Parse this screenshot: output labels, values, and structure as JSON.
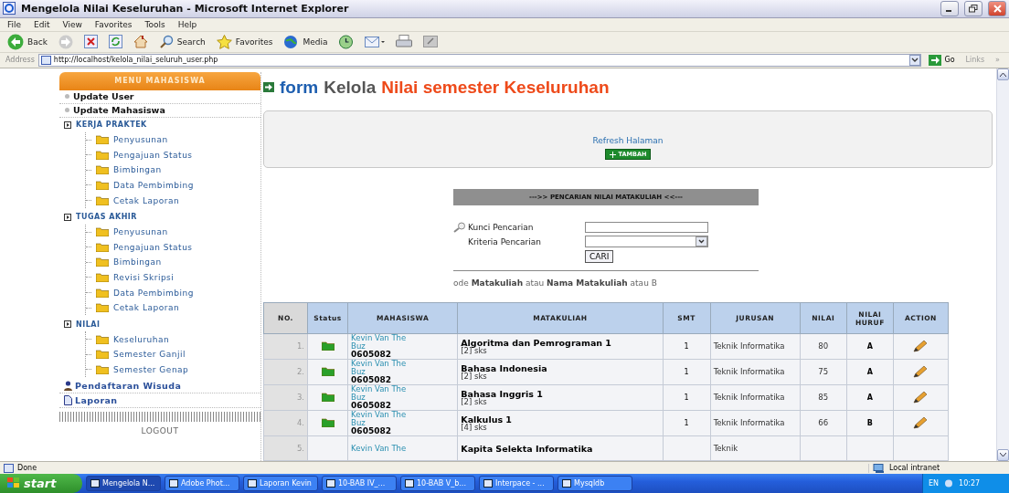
{
  "window": {
    "title": "Mengelola Nilai Keseluruhan - Microsoft Internet Explorer"
  },
  "menu": [
    "File",
    "Edit",
    "View",
    "Favorites",
    "Tools",
    "Help"
  ],
  "toolbar": [
    {
      "kind": "back",
      "label": "Back"
    },
    {
      "kind": "forward"
    },
    {
      "kind": "stop"
    },
    {
      "kind": "refresh"
    },
    {
      "kind": "home"
    },
    {
      "kind": "search",
      "label": "Search"
    },
    {
      "kind": "favorites",
      "label": "Favorites"
    },
    {
      "kind": "media",
      "label": "Media"
    },
    {
      "kind": "history"
    },
    {
      "kind": "mail"
    },
    {
      "kind": "print"
    },
    {
      "kind": "edit"
    }
  ],
  "address_bar": {
    "label": "Address",
    "url": "http://localhost/kelola_nilai_seluruh_user.php",
    "go": "Go",
    "links": "Links",
    "more": "»"
  },
  "sidebar": {
    "title": "MENU MAHASISWA",
    "logout": "LOGOUT",
    "items": [
      {
        "kind": "bullet",
        "label": "Update User"
      },
      {
        "kind": "bullet",
        "label": "Update Mahasiswa"
      },
      {
        "kind": "group",
        "label": "KERJA PRAKTEK",
        "children": [
          {
            "label": "Penyusunan"
          },
          {
            "label": "Pengajuan Status"
          },
          {
            "label": "Bimbingan"
          },
          {
            "label": "Data Pembimbing"
          },
          {
            "label": "Cetak Laporan"
          }
        ]
      },
      {
        "kind": "group",
        "label": "TUGAS AKHIR",
        "children": [
          {
            "label": "Penyusunan"
          },
          {
            "label": "Pengajuan Status"
          },
          {
            "label": "Bimbingan"
          },
          {
            "label": "Revisi Skripsi"
          },
          {
            "label": "Data Pembimbing"
          },
          {
            "label": "Cetak Laporan"
          }
        ]
      },
      {
        "kind": "group",
        "label": "NILAI",
        "children": [
          {
            "label": "Keseluruhan"
          },
          {
            "label": "Semester Ganjil"
          },
          {
            "label": "Semester Genap"
          }
        ]
      },
      {
        "kind": "person",
        "label": "Pendaftaran Wisuda"
      },
      {
        "kind": "page",
        "label": "Laporan"
      }
    ]
  },
  "main": {
    "heading": [
      "form",
      "Kelola",
      "Nilai semester Keseluruhan"
    ],
    "refresh_link": "Refresh Halaman",
    "add_button": "TAMBAH",
    "search": {
      "title": "--->> PENCARIAN NILAI MATAKULIAH <<---",
      "key_label": "Kunci Pencarian",
      "criteria_label": "Kriteria Pencarian",
      "submit": "CARI",
      "hint": "ode **Matakuliah** atau **Nama Matakuliah** atau B"
    }
  },
  "table": {
    "columns": [
      "NO.",
      "Status",
      "MAHASISWA",
      "MATAKULIAH",
      "SMT",
      "JURUSAN",
      "NILAI",
      "NILAI HURUF",
      "ACTION"
    ],
    "rows": [
      {
        "no": "1.",
        "name": "Kevin Van The Buz",
        "nim": "0605082",
        "course": "Algoritma dan Pemrograman 1",
        "sks": "[2] sks",
        "smt": "1",
        "jurusan": "Teknik Informatika",
        "nilai": "80",
        "huruf": "A"
      },
      {
        "no": "2.",
        "name": "Kevin Van The Buz",
        "nim": "0605082",
        "course": "Bahasa Indonesia",
        "sks": "[2] sks",
        "smt": "1",
        "jurusan": "Teknik Informatika",
        "nilai": "75",
        "huruf": "A"
      },
      {
        "no": "3.",
        "name": "Kevin Van The Buz",
        "nim": "0605082",
        "course": "Bahasa Inggris 1",
        "sks": "[2] sks",
        "smt": "1",
        "jurusan": "Teknik Informatika",
        "nilai": "85",
        "huruf": "A"
      },
      {
        "no": "4.",
        "name": "Kevin Van The Buz",
        "nim": "0605082",
        "course": "Kalkulus 1",
        "sks": "[4] sks",
        "smt": "1",
        "jurusan": "Teknik Informatika",
        "nilai": "66",
        "huruf": "B"
      },
      {
        "no": "5.",
        "name": "Kevin Van The",
        "course": "Kapita Selekta Informatika",
        "jurusan": "Teknik"
      }
    ]
  },
  "status_bar": {
    "text": "Done",
    "zone": "Local intranet"
  },
  "taskbar": {
    "start": "start",
    "items": [
      {
        "label": "Mengelola N...",
        "selected": true
      },
      {
        "label": "Adobe Phot...",
        "selected": false
      },
      {
        "label": "Laporan Kevin",
        "selected": false
      },
      {
        "label": "10-BAB IV_...",
        "selected": false
      },
      {
        "label": "10-BAB V_b...",
        "selected": false
      },
      {
        "label": "Interpace - ...",
        "selected": false
      },
      {
        "label": "Mysqldb",
        "selected": false
      }
    ],
    "language": "EN",
    "clock": "10:27"
  }
}
